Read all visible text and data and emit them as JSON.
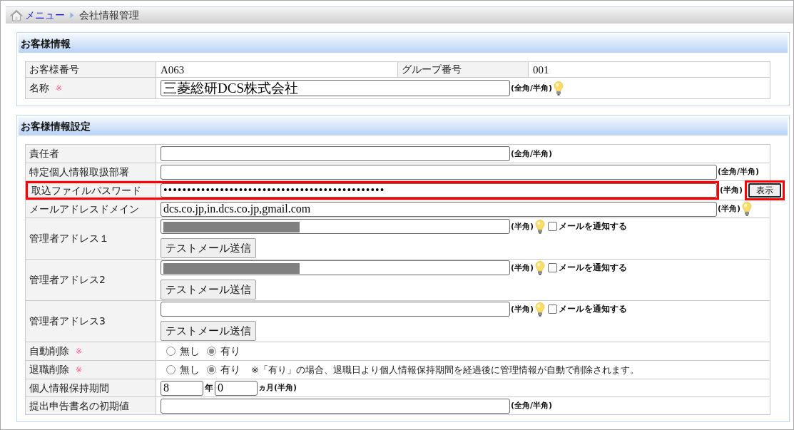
{
  "breadcrumb": [
    {
      "label": "メニュー",
      "kind": "link"
    },
    {
      "label": "会社情報管理",
      "kind": "current"
    }
  ],
  "customer_info": {
    "title": "お客様情報",
    "rows": [
      {
        "kind": "pair",
        "cells": [
          {
            "label": "お客様番号",
            "value": "A063"
          },
          {
            "label": "グループ番号",
            "value": "001"
          }
        ]
      },
      {
        "kind": "text",
        "label": "名称",
        "mark": "※",
        "value": "三菱総研DCS株式会社",
        "hint": "(全角/半角)",
        "tip": true
      }
    ]
  },
  "settings": {
    "title": "お客様情報設定",
    "rows": [
      {
        "kind": "text",
        "label": "責任者",
        "hint": "(全角/半角)",
        "tip": false,
        "highlighted": false
      },
      {
        "kind": "text_wide",
        "label": "特定個人情報取扱部署",
        "hint": "(全角/半角)",
        "tip": false,
        "highlighted": false
      },
      {
        "kind": "password",
        "label": "取込ファイルパスワード",
        "value": "•••••••••••••••••••••••••••••••••••••••••••••••",
        "hint": "(半角)",
        "tip": false,
        "highlighted": true,
        "button": {
          "label": "表示",
          "highlighted": true
        }
      },
      {
        "kind": "text_wide",
        "label": "メールアドレスドメイン",
        "value": "dcs.co.jp,in.dcs.co.jp,gmail.com",
        "hint": "(半角)",
        "tip": true,
        "highlighted": false
      },
      {
        "kind": "address",
        "label": "管理者アドレス１",
        "redacted": true,
        "hint": "(半角)",
        "tip": true,
        "highlighted": false,
        "checkbox": {
          "label": "メールを通知する",
          "checked": false
        },
        "button": {
          "label": "テストメール送信"
        }
      },
      {
        "kind": "address",
        "label": "管理者アドレス2",
        "redacted": true,
        "hint": "(半角)",
        "tip": true,
        "highlighted": false,
        "checkbox": {
          "label": "メールを通知する",
          "checked": false
        },
        "button": {
          "label": "テストメール送信"
        }
      },
      {
        "kind": "address",
        "label": "管理者アドレス3",
        "redacted": false,
        "hint": "(半角)",
        "tip": true,
        "highlighted": false,
        "checkbox": {
          "label": "メールを通知する",
          "checked": false
        },
        "button": {
          "label": "テストメール送信"
        }
      },
      {
        "kind": "radio",
        "label": "自動削除",
        "mark": "※",
        "highlighted": false,
        "options": [
          {
            "label": "無し",
            "selected": false
          },
          {
            "label": "有り",
            "selected": true
          }
        ]
      },
      {
        "kind": "radio",
        "label": "退職削除",
        "mark": "※",
        "highlighted": false,
        "options": [
          {
            "label": "無し",
            "selected": false
          },
          {
            "label": "有り",
            "selected": true
          }
        ],
        "note": "※「有り」の場合、退職日より個人情報保持期間を経過後に管理情報が自動で削除されます。"
      },
      {
        "kind": "period",
        "label": "個人情報保持期間",
        "highlighted": false,
        "years": "8",
        "year_unit": "年",
        "months": "0",
        "month_unit": "ヵ月(半角)"
      },
      {
        "kind": "text",
        "label": "提出申告書名の初期値",
        "hint": "(全角/半角)",
        "tip": false,
        "highlighted": false
      }
    ]
  }
}
